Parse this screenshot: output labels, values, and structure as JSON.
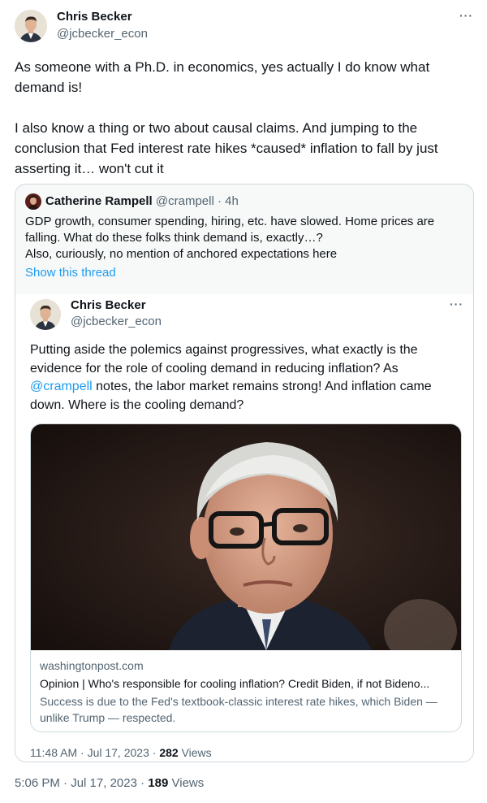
{
  "main_tweet": {
    "author_name": "Chris Becker",
    "author_handle": "@jcbecker_econ",
    "more_icon": "more-horizontal-icon",
    "paragraphs": [
      "As someone with a Ph.D. in economics, yes actually I do know what demand is!",
      "I also know a thing or two about causal claims. And jumping to the conclusion that Fed interest rate hikes *caused* inflation to fall by just asserting it… won't cut it"
    ],
    "time": "5:06 PM",
    "date": "Jul 17, 2023",
    "views_count": "189",
    "views_label": "Views"
  },
  "quoted_tweet": {
    "author_name": "Catherine Rampell",
    "author_handle": "@crampell",
    "age": "4h",
    "lines": [
      "GDP growth, consumer spending, hiring, etc. have slowed. Home prices are",
      "falling. What do these folks think demand is, exactly…?",
      "Also, curiously, no mention of anchored expectations here"
    ],
    "show_thread": "Show this thread"
  },
  "inner_tweet": {
    "author_name": "Chris Becker",
    "author_handle": "@jcbecker_econ",
    "text_before": "Putting aside the polemics against progressives, what exactly is the evidence for the role of cooling demand in reducing inflation? As ",
    "mention": "@crampell",
    "text_after": " notes, the labor market remains strong! And inflation came down. Where is the cooling demand?",
    "time": "11:48 AM",
    "date": "Jul 17, 2023",
    "views_count": "282",
    "views_label": "Views"
  },
  "link_card": {
    "domain": "washingtonpost.com",
    "title": "Opinion | Who's responsible for cooling inflation? Credit Biden, if not Bideno...",
    "description": "Success is due to the Fed's textbook-classic interest rate hikes, which Biden — unlike Trump — respected."
  }
}
